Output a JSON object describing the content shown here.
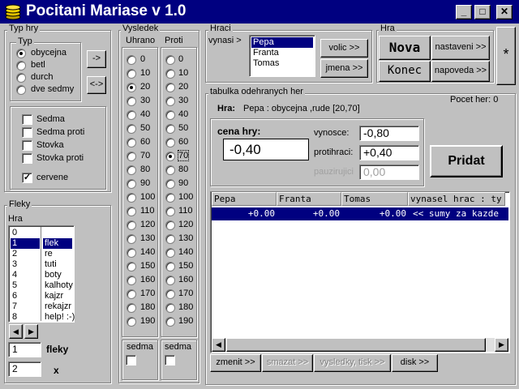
{
  "window": {
    "title": "Pocitani Mariase v 1.0",
    "minimize": "_",
    "maximize": "□",
    "close": "✕"
  },
  "typ_hry": {
    "title": "Typ hry",
    "typ_title": "Typ",
    "options": [
      "obycejna",
      "betl",
      "durch",
      "dve sedmy"
    ],
    "selected": 0,
    "arrow_right": "->",
    "arrow_both": "<->",
    "checks": [
      {
        "label": "Sedma",
        "checked": false
      },
      {
        "label": "Sedma proti",
        "checked": false
      },
      {
        "label": "Stovka",
        "checked": false
      },
      {
        "label": "Stovka proti",
        "checked": false
      },
      {
        "label": "cervene",
        "checked": true
      }
    ]
  },
  "fleky": {
    "title": "Fleky",
    "hra_label": "Hra",
    "numbers": [
      "0",
      "1",
      "2",
      "3",
      "4",
      "5",
      "6",
      "7",
      "8"
    ],
    "names": [
      "",
      "flek",
      "re",
      "tuti",
      "boty",
      "kalhoty",
      "kajzr",
      "rekajzr",
      "help! :-)"
    ],
    "selected": 1,
    "fleky_value": "1",
    "fleky_label": "fleky",
    "x_value": "2",
    "x_label": "x"
  },
  "vysledek": {
    "title": "Vysledek",
    "uhrano_label": "Uhrano",
    "proti_label": "Proti",
    "values": [
      "0",
      "10",
      "20",
      "30",
      "40",
      "50",
      "60",
      "70",
      "80",
      "90",
      "100",
      "110",
      "120",
      "130",
      "140",
      "150",
      "160",
      "170",
      "180",
      "190"
    ],
    "uhrano_selected": 2,
    "proti_selected": 7,
    "sedma_label": "sedma",
    "sedma2_label": "sedma"
  },
  "hraci": {
    "title": "Hraci",
    "vynasi_label": "vynasi >",
    "players": [
      "Pepa",
      "Franta",
      "Tomas"
    ],
    "selected": 0,
    "volic_button": "volic >>",
    "jmena_button": "jmena >>"
  },
  "hra": {
    "title": "Hra",
    "nova": "Nova",
    "nastaveni": "nastaveni >>",
    "konec": "Konec",
    "napoveda": "napoveda >>",
    "star": "*"
  },
  "tabulka": {
    "title": "tabulka odehranych her",
    "pocet_her": "Pocet her: 0",
    "hra_label": "Hra:",
    "hra_info": "Pepa : obycejna  ,rude [20,70]",
    "cena_label": "cena hry:",
    "cena_value": "-0,40",
    "vynosce_label": "vynosce:",
    "vynosce_value": "-0,80",
    "protihraci_label": "protihraci:",
    "protihraci_value": "+0,40",
    "pauzirujici_label": "pauzirujici",
    "pauzirujici_value": "0,00",
    "pridat": "Pridat",
    "columns": [
      "Pepa",
      "Franta",
      "Tomas",
      "vynasel hrac : ty"
    ],
    "row": [
      "+0.00",
      "+0.00",
      "+0.00",
      "<< sumy za kazde"
    ],
    "zmenit": "zmenit >>",
    "smazat": "smazat >>",
    "vysledky": "vysledky, tisk >>",
    "disk": "disk >>"
  },
  "colors": {
    "title_bar": "#000080",
    "face": "#c0c0c0",
    "selection": "#000080"
  }
}
